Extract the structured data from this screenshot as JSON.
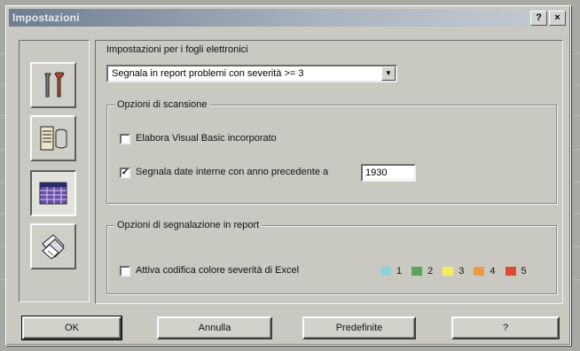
{
  "window": {
    "title": "Impostazioni",
    "help_button": "?",
    "close_button": "×"
  },
  "sheet_settings": {
    "label": "Impostazioni per i fogli elettronici",
    "dropdown_value": "Segnala in report problemi con severità >= 3"
  },
  "scan_options": {
    "title": "Opzioni di scansione",
    "vba_label": "Elabora Visual Basic incorporato",
    "vba_checked": false,
    "date_label": "Segnala date interne con anno precedente a",
    "date_checked": true,
    "year_value": "1930"
  },
  "report_options": {
    "title": "Opzioni di segnalazione in report",
    "color_label": "Attiva codifica colore severità di Excel",
    "color_checked": false,
    "severity_levels": [
      {
        "num": "1",
        "color": "#8fd0dc"
      },
      {
        "num": "2",
        "color": "#5aa65a"
      },
      {
        "num": "3",
        "color": "#f3ec62"
      },
      {
        "num": "4",
        "color": "#eb9a42"
      },
      {
        "num": "5",
        "color": "#de4a2f"
      }
    ]
  },
  "buttons": {
    "ok": "OK",
    "cancel": "Annulla",
    "defaults": "Predefinite",
    "help": "?"
  },
  "side_icons": [
    "tools-icon",
    "database-icon",
    "spreadsheet-icon",
    "documents-icon"
  ],
  "active_icon": "spreadsheet-icon"
}
